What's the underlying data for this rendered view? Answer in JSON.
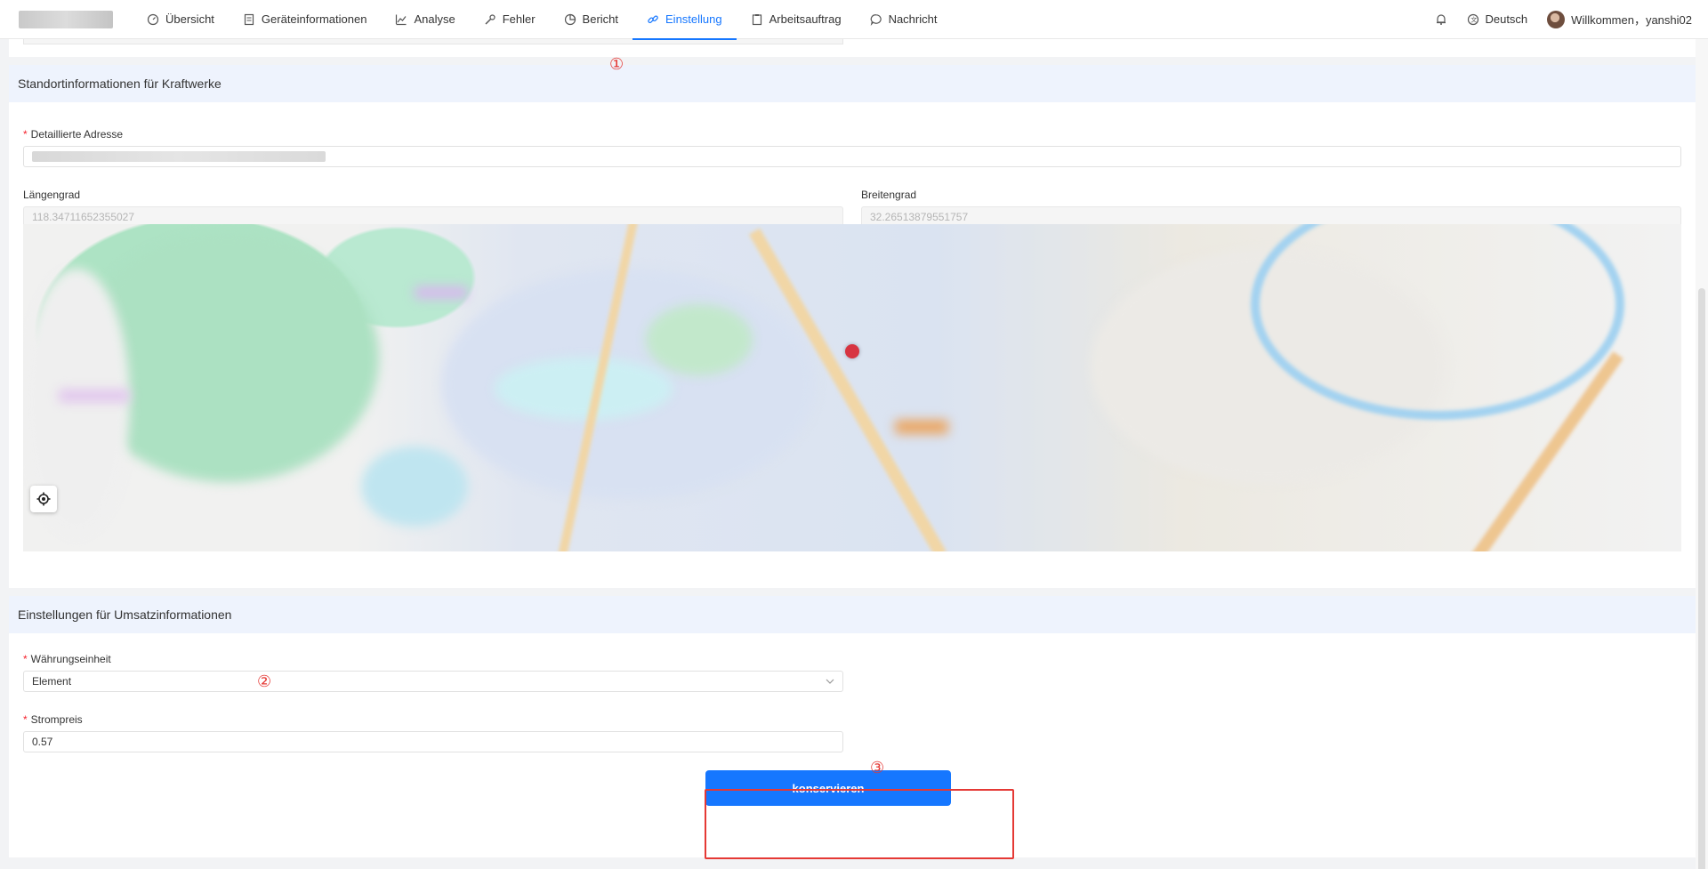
{
  "nav": {
    "items": [
      {
        "label": "Übersicht",
        "icon": "dashboard-icon"
      },
      {
        "label": "Geräteinformationen",
        "icon": "list-icon"
      },
      {
        "label": "Analyse",
        "icon": "chart-icon"
      },
      {
        "label": "Fehler",
        "icon": "wrench-icon"
      },
      {
        "label": "Bericht",
        "icon": "pie-icon"
      },
      {
        "label": "Einstellung",
        "icon": "link-icon",
        "active": true
      },
      {
        "label": "Arbeitsauftrag",
        "icon": "clipboard-icon"
      },
      {
        "label": "Nachricht",
        "icon": "chat-icon"
      }
    ],
    "language": "Deutsch",
    "welcome": "Willkommen，yanshi02"
  },
  "location_section": {
    "title": "Standortinformationen für Kraftwerke",
    "address_label": "Detaillierte Adresse",
    "longitude_label": "Längengrad",
    "longitude_value": "118.34711652355027",
    "latitude_label": "Breitengrad",
    "latitude_value": "32.26513879551757"
  },
  "revenue_section": {
    "title": "Einstellungen für Umsatzinformationen",
    "currency_label": "Währungseinheit",
    "currency_value": "Element",
    "price_label": "Strompreis",
    "price_value": "0.57"
  },
  "save_label": "konservieren",
  "annotations": [
    "①",
    "②",
    "③"
  ],
  "colors": {
    "accent": "#1677ff",
    "annotation": "#e53935",
    "section_header": "#eef3fd"
  }
}
